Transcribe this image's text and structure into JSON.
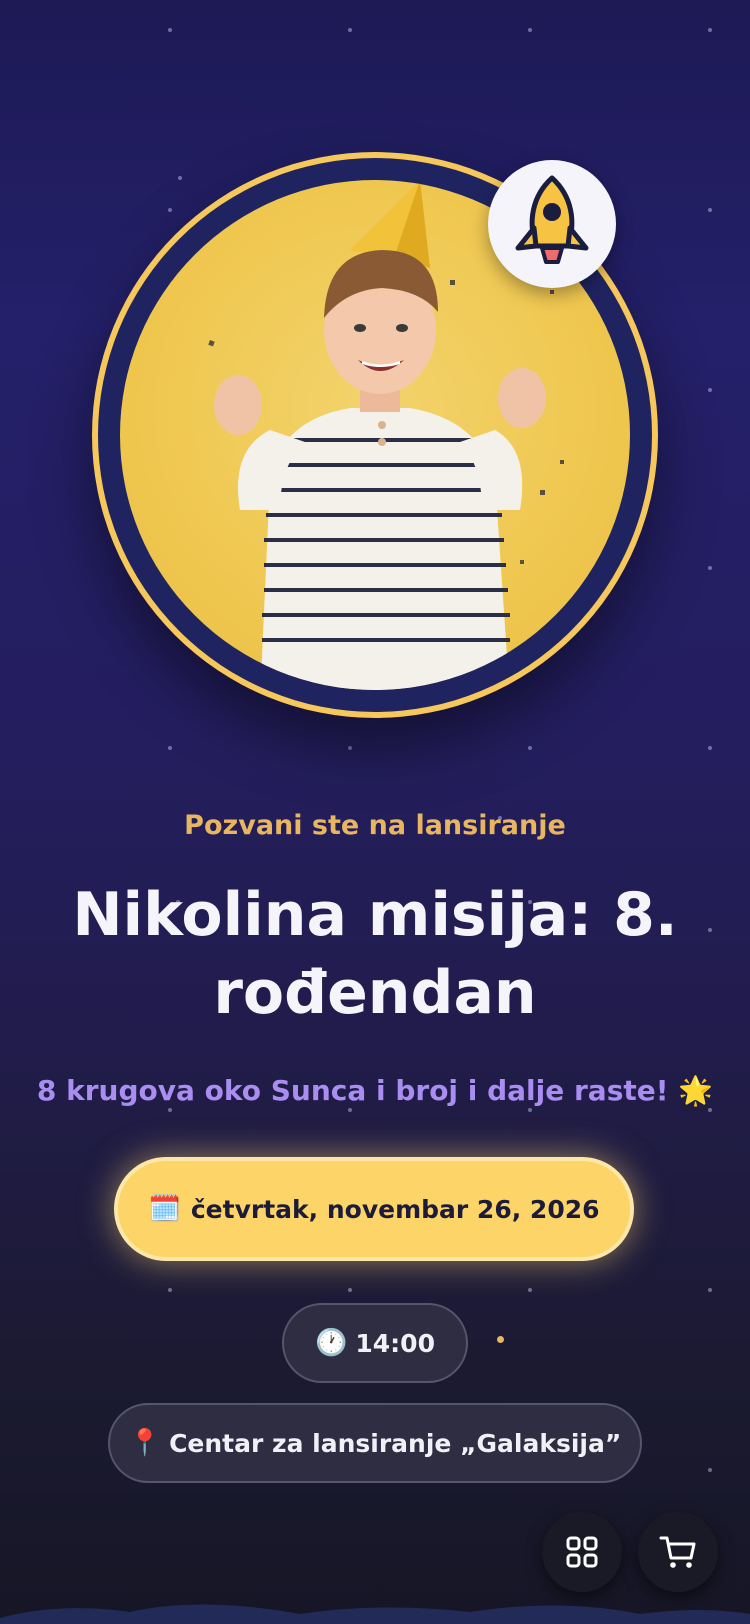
{
  "invitation": {
    "eyebrow": "Pozvani ste na lansiranje",
    "title": "Nikolina misija: 8. rođendan",
    "subtitle": "8 krugova oko Sunca i broj i dalje raste! 🌟",
    "date": {
      "icon": "🗓️",
      "text": "četvrtak, novembar 26, 2026"
    },
    "time": {
      "icon": "🕐",
      "text": "14:00"
    },
    "location": {
      "icon": "📍",
      "text": "Centar za lansiranje „Galaksija”"
    }
  },
  "hero": {
    "badge_icon": "rocket-icon",
    "photo": "boy-with-party-hat"
  },
  "actions": {
    "apps_icon": "apps-grid-icon",
    "cart_icon": "cart-icon"
  },
  "colors": {
    "accent_yellow": "#fcd467",
    "accent_purple": "#a98df0",
    "eyebrow_gold": "#e8b661",
    "navy": "#1f2460"
  }
}
